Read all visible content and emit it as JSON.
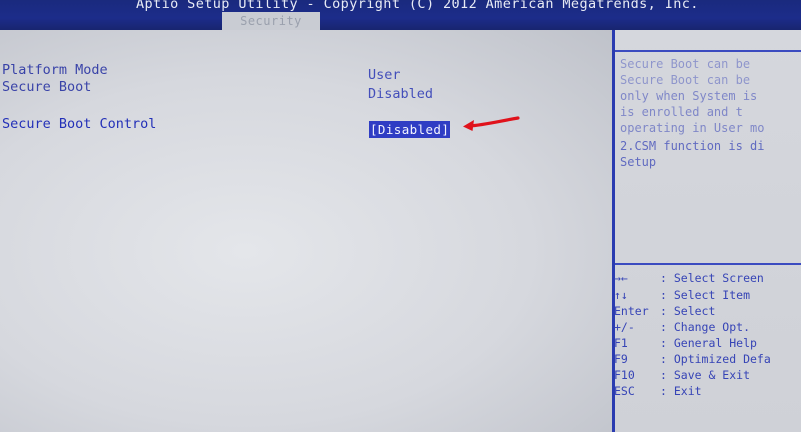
{
  "header": {
    "title": "Aptio Setup Utility - Copyright (C) 2012 American Megatrends, Inc.",
    "active_tab": "Security"
  },
  "main": {
    "rows": [
      {
        "label": "Platform Mode",
        "value": "User"
      },
      {
        "label": "Secure Boot",
        "value": "Disabled"
      },
      {
        "label": "Secure Boot Control",
        "value": "[Disabled]"
      }
    ]
  },
  "help": {
    "lines": [
      "Secure Boot can be",
      "Secure Boot can be",
      "only when System is",
      "is enrolled and t",
      "operating in User mo",
      "2.CSM function is di",
      "Setup"
    ]
  },
  "keys": [
    {
      "key": "→←",
      "desc": ": Select Screen"
    },
    {
      "key": "↑↓",
      "desc": ": Select Item"
    },
    {
      "key": "Enter",
      "desc": ": Select"
    },
    {
      "key": "+/-",
      "desc": ": Change Opt."
    },
    {
      "key": "F1",
      "desc": ": General Help"
    },
    {
      "key": "F9",
      "desc": ": Optimized Defa"
    },
    {
      "key": "F10",
      "desc": ": Save & Exit"
    },
    {
      "key": "ESC",
      "desc": ": Exit"
    }
  ],
  "colors": {
    "title_bar": "#1c2c8a",
    "highlight": "#2f3dc4",
    "arrow": "#e0121b"
  }
}
